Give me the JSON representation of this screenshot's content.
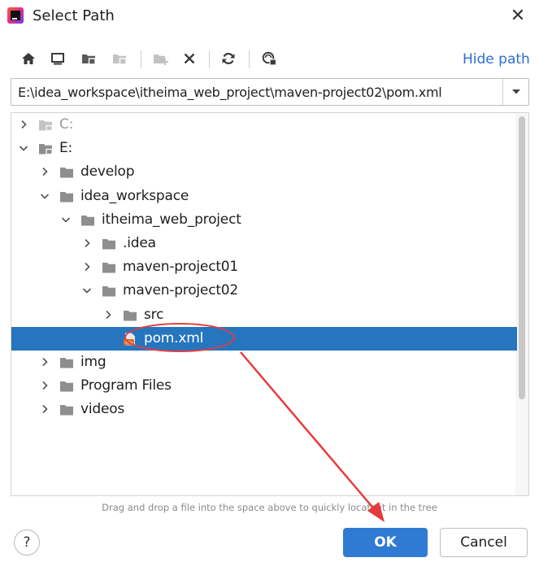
{
  "dialog": {
    "title": "Select Path",
    "close_glyph": "✕"
  },
  "toolbar": {
    "icons": [
      "home-icon",
      "desktop-icon",
      "project-folder-icon",
      "module-folder-icon",
      "new-folder-icon",
      "delete-icon",
      "refresh-icon",
      "show-hidden-icon"
    ],
    "hide_path_label": "Hide path"
  },
  "path": {
    "value": "E:\\idea_workspace\\itheima_web_project\\maven-project02\\pom.xml"
  },
  "tree": {
    "items": [
      {
        "label": "C:",
        "level": 0,
        "expanded": false,
        "type": "drive",
        "dim": true
      },
      {
        "label": "E:",
        "level": 0,
        "expanded": true,
        "type": "drive"
      },
      {
        "label": "develop",
        "level": 1,
        "expanded": false,
        "type": "folder"
      },
      {
        "label": "idea_workspace",
        "level": 1,
        "expanded": true,
        "type": "folder"
      },
      {
        "label": "itheima_web_project",
        "level": 2,
        "expanded": true,
        "type": "folder"
      },
      {
        "label": ".idea",
        "level": 3,
        "expanded": false,
        "type": "folder"
      },
      {
        "label": "maven-project01",
        "level": 3,
        "expanded": false,
        "type": "folder"
      },
      {
        "label": "maven-project02",
        "level": 3,
        "expanded": true,
        "type": "folder"
      },
      {
        "label": "src",
        "level": 4,
        "expanded": false,
        "type": "folder"
      },
      {
        "label": "pom.xml",
        "level": 4,
        "type": "file",
        "selected": true
      },
      {
        "label": "img",
        "level": 1,
        "expanded": false,
        "type": "folder"
      },
      {
        "label": "Program Files",
        "level": 1,
        "expanded": false,
        "type": "folder"
      },
      {
        "label": "videos",
        "level": 1,
        "expanded": false,
        "type": "folder"
      }
    ]
  },
  "hint": "Drag and drop a file into the space above to quickly locate it in the tree",
  "buttons": {
    "help_label": "?",
    "ok_label": "OK",
    "cancel_label": "Cancel"
  },
  "colors": {
    "accent": "#2f7bd3",
    "selection": "#2675bf",
    "link": "#2b6fd1",
    "annotation": "#e63b3b"
  }
}
